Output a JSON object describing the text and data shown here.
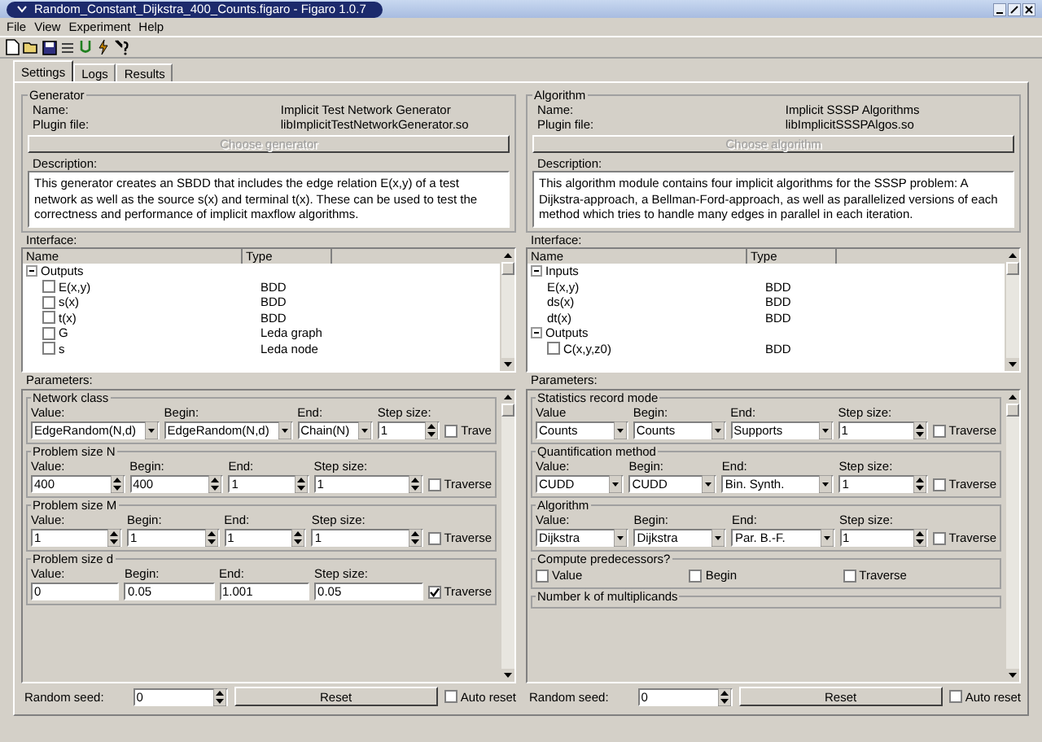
{
  "window": {
    "title": "Random_Constant_Dijkstra_400_Counts.figaro - Figaro 1.0.7"
  },
  "menu": [
    "File",
    "View",
    "Experiment",
    "Help"
  ],
  "tabs": [
    {
      "label": "Settings",
      "selected": true
    },
    {
      "label": "Logs",
      "selected": false
    },
    {
      "label": "Results",
      "selected": false
    }
  ],
  "panels": [
    {
      "group_title": "Generator",
      "name_label": "Name:",
      "name": "Implicit Test Network Generator",
      "plugin_label": "Plugin file:",
      "plugin": "libImplicitTestNetworkGenerator.so",
      "choose_button": {
        "label": "Choose generator",
        "disabled": true
      },
      "description_label": "Description:",
      "description": "This generator creates an SBDD that includes the edge relation E(x,y) of a test network as well as the source s(x) and terminal t(x). These can be used to test the correctness and performance of implicit maxflow algorithms.",
      "interface_label": "Interface:",
      "interface": {
        "columns": [
          "Name",
          "Type"
        ],
        "rows": [
          {
            "name": "Outputs",
            "type": "",
            "expanded": true,
            "children": [
              {
                "name": "E(x,y)",
                "type": "BDD",
                "checked": false
              },
              {
                "name": "s(x)",
                "type": "BDD",
                "checked": false
              },
              {
                "name": "t(x)",
                "type": "BDD",
                "checked": false
              },
              {
                "name": "G",
                "type": "Leda graph",
                "checked": false
              },
              {
                "name": "s",
                "type": "Leda node",
                "checked": false
              }
            ]
          }
        ]
      },
      "parameters_label": "Parameters:",
      "parameters": [
        {
          "title": "Network class",
          "kind": "range",
          "fields": [
            {
              "label": "Value:",
              "kind": "combo",
              "value": "EdgeRandom(N,d)"
            },
            {
              "label": "Begin:",
              "kind": "combo",
              "value": "EdgeRandom(N,d)"
            },
            {
              "label": "End:",
              "kind": "combo",
              "value": "Chain(N)"
            },
            {
              "label": "Step size:",
              "kind": "spin",
              "value": "1"
            }
          ],
          "traverse": {
            "label": "Trave",
            "checked": false
          }
        },
        {
          "title": "Problem size N",
          "kind": "range",
          "fields": [
            {
              "label": "Value:",
              "kind": "spin",
              "value": "400"
            },
            {
              "label": "Begin:",
              "kind": "spin",
              "value": "400"
            },
            {
              "label": "End:",
              "kind": "spin",
              "value": "1"
            },
            {
              "label": "Step size:",
              "kind": "spin",
              "value": "1"
            }
          ],
          "traverse": {
            "label": "Traverse",
            "checked": false
          }
        },
        {
          "title": "Problem size M",
          "kind": "range",
          "fields": [
            {
              "label": "Value:",
              "kind": "spin",
              "value": "1"
            },
            {
              "label": "Begin:",
              "kind": "spin",
              "value": "1"
            },
            {
              "label": "End:",
              "kind": "spin",
              "value": "1"
            },
            {
              "label": "Step size:",
              "kind": "spin",
              "value": "1"
            }
          ],
          "traverse": {
            "label": "Traverse",
            "checked": false
          }
        },
        {
          "title": "Problem size d",
          "kind": "range",
          "fields": [
            {
              "label": "Value:",
              "kind": "text",
              "value": "0"
            },
            {
              "label": "Begin:",
              "kind": "text",
              "value": "0.05"
            },
            {
              "label": "End:",
              "kind": "text",
              "value": "1.001"
            },
            {
              "label": "Step size:",
              "kind": "text",
              "value": "0.05"
            }
          ],
          "traverse": {
            "label": "Traverse",
            "checked": true
          }
        }
      ],
      "random_seed_label": "Random seed:",
      "random_seed": "0",
      "reset_button": "Reset",
      "auto_reset": {
        "label": "Auto reset",
        "checked": false
      }
    },
    {
      "group_title": "Algorithm",
      "name_label": "Name:",
      "name": "Implicit SSSP Algorithms",
      "plugin_label": "Plugin file:",
      "plugin": "libImplicitSSSPAlgos.so",
      "choose_button": {
        "label": "Choose algorithm",
        "disabled": true
      },
      "description_label": "Description:",
      "description": "This algorithm module contains four implicit algorithms for the SSSP problem: A Dijkstra-approach, a Bellman-Ford-approach, as well as parallelized versions of each method which tries to handle many edges in parallel in each iteration.",
      "interface_label": "Interface:",
      "interface": {
        "columns": [
          "Name",
          "Type"
        ],
        "rows": [
          {
            "name": "Inputs",
            "type": "",
            "expanded": true,
            "children": [
              {
                "name": "E(x,y)",
                "type": "BDD"
              },
              {
                "name": "ds(x)",
                "type": "BDD"
              },
              {
                "name": "dt(x)",
                "type": "BDD"
              }
            ]
          },
          {
            "name": "Outputs",
            "type": "",
            "expanded": true,
            "children": [
              {
                "name": "C(x,y,z0)",
                "type": "BDD",
                "checked": false
              }
            ]
          }
        ]
      },
      "parameters_label": "Parameters:",
      "parameters": [
        {
          "title": "Statistics record mode",
          "kind": "range",
          "fields": [
            {
              "label": "Value",
              "kind": "combo",
              "value": "Counts"
            },
            {
              "label": "Begin:",
              "kind": "combo",
              "value": "Counts"
            },
            {
              "label": "End:",
              "kind": "combo",
              "value": "Supports"
            },
            {
              "label": "Step size:",
              "kind": "spin",
              "value": "1"
            }
          ],
          "traverse": {
            "label": "Traverse",
            "checked": false
          }
        },
        {
          "title": "Quantification method",
          "kind": "range",
          "fields": [
            {
              "label": "Value:",
              "kind": "combo",
              "value": "CUDD"
            },
            {
              "label": "Begin:",
              "kind": "combo",
              "value": "CUDD"
            },
            {
              "label": "End:",
              "kind": "combo",
              "value": "Bin. Synth."
            },
            {
              "label": "Step size:",
              "kind": "spin",
              "value": "1"
            }
          ],
          "traverse": {
            "label": "Traverse",
            "checked": false
          }
        },
        {
          "title": "Algorithm",
          "kind": "range",
          "fields": [
            {
              "label": "Value:",
              "kind": "combo",
              "value": "Dijkstra"
            },
            {
              "label": "Begin:",
              "kind": "combo",
              "value": "Dijkstra"
            },
            {
              "label": "End:",
              "kind": "combo",
              "value": "Par. B.-F."
            },
            {
              "label": "Step size:",
              "kind": "spin",
              "value": "1"
            }
          ],
          "traverse": {
            "label": "Traverse",
            "checked": false
          }
        },
        {
          "title": "Compute predecessors?",
          "kind": "checks",
          "checks": [
            {
              "label": "Value",
              "checked": false
            },
            {
              "label": "Begin",
              "checked": false
            },
            {
              "label": "Traverse",
              "checked": false
            }
          ]
        },
        {
          "title": "Number k of multiplicands",
          "kind": "title_only"
        }
      ],
      "random_seed_label": "Random seed:",
      "random_seed": "0",
      "reset_button": "Reset",
      "auto_reset": {
        "label": "Auto reset",
        "checked": false
      }
    }
  ]
}
